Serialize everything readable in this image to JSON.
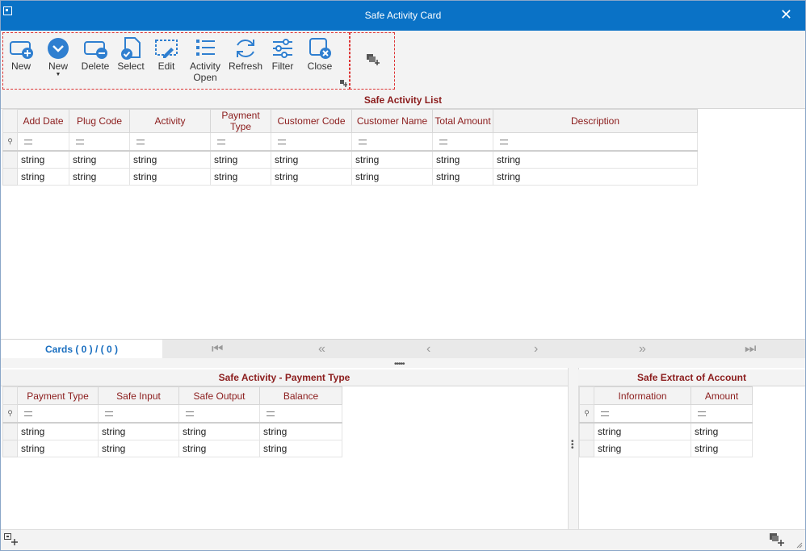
{
  "window": {
    "title": "Safe Activity Card",
    "close_glyph": "✕"
  },
  "toolbar": {
    "buttons": [
      {
        "label": "New",
        "icon": "add-card-icon"
      },
      {
        "label": "New",
        "icon": "chevron-down-circle-icon",
        "has_dropdown": true
      },
      {
        "label": "Delete",
        "icon": "remove-card-icon"
      },
      {
        "label": "Select",
        "icon": "select-document-icon"
      },
      {
        "label": "Edit",
        "icon": "edit-icon"
      },
      {
        "label": "Activity Open",
        "line1": "Activity",
        "line2": "Open",
        "icon": "list-icon"
      },
      {
        "label": "Refresh",
        "icon": "refresh-icon"
      },
      {
        "label": "Filter",
        "icon": "filter-sliders-icon"
      },
      {
        "label": "Close",
        "icon": "close-window-icon"
      }
    ],
    "accent": "#2f7fd0"
  },
  "activity_list": {
    "caption": "Safe Activity List",
    "columns": [
      "Add Date",
      "Plug Code",
      "Activity",
      "Payment Type",
      "Customer Code",
      "Customer Name",
      "Total Amount",
      "Description"
    ],
    "rows": [
      [
        "string",
        "string",
        "string",
        "string",
        "string",
        "string",
        "string",
        "string"
      ],
      [
        "string",
        "string",
        "string",
        "string",
        "string",
        "string",
        "string",
        "string"
      ]
    ]
  },
  "pager": {
    "cards_text": "Cards ( 0 ) / ( 0 )"
  },
  "payment_type": {
    "caption": "Safe Activity - Payment Type",
    "columns": [
      "Payment Type",
      "Safe Input",
      "Safe Output",
      "Balance"
    ],
    "rows": [
      [
        "string",
        "string",
        "string",
        "string"
      ],
      [
        "string",
        "string",
        "string",
        "string"
      ]
    ]
  },
  "extract": {
    "caption": "Safe Extract of Account",
    "columns": [
      "Information",
      "Amount"
    ],
    "rows": [
      [
        "string",
        "string"
      ],
      [
        "string",
        "string"
      ]
    ]
  },
  "colors": {
    "titlebar": "#0a72c6",
    "header_text": "#8b1c1c",
    "pager_text": "#1a6fc0"
  }
}
